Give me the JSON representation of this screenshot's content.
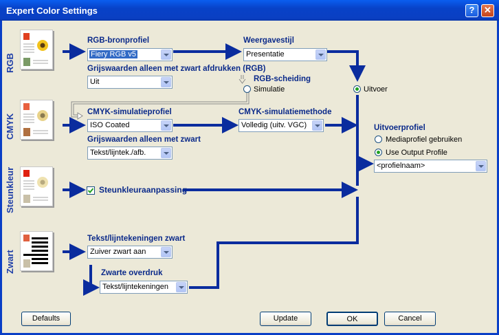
{
  "window": {
    "title": "Expert Color Settings",
    "help": "?",
    "close": "✕"
  },
  "side_labels": {
    "rgb": "RGB",
    "cmyk": "CMYK",
    "spot": "Steunkleur",
    "black": "Zwart"
  },
  "rgb": {
    "source_label": "RGB-bronprofiel",
    "source_value": "Fiery RGB v5",
    "render_label": "Weergavestijl",
    "render_value": "Presentatie",
    "gray_label": "Grijswaarden alleen met zwart afdrukken (RGB)",
    "gray_value": "Uit",
    "separation_label": "RGB-scheiding",
    "sim_radio": "Simulatie",
    "output_radio": "Uitvoer"
  },
  "cmyk": {
    "sim_label": "CMYK-simulatieprofiel",
    "sim_value": "ISO Coated",
    "method_label": "CMYK-simulatiemethode",
    "method_value": "Volledig (uitv. VGC)",
    "gray_label": "Grijswaarden alleen met zwart",
    "gray_value": "Tekst/lijntek./afb."
  },
  "output": {
    "label": "Uitvoerprofiel",
    "radio_media": "Mediaprofiel gebruiken",
    "radio_output": "Use Output Profile",
    "profile_value": "<profielnaam>"
  },
  "spot": {
    "check_label": "Steunkleuraanpassing"
  },
  "black": {
    "text_label": "Tekst/lijntekeningen zwart",
    "text_value": "Zuiver zwart aan",
    "overprint_label": "Zwarte overdruk",
    "overprint_value": "Tekst/lijntekeningen"
  },
  "buttons": {
    "defaults": "Defaults",
    "update": "Update",
    "ok": "OK",
    "cancel": "Cancel"
  },
  "colors": {
    "flow": "#0a2c9e",
    "label": "#0b2a8a",
    "title_bar": "#0a4fd8"
  }
}
